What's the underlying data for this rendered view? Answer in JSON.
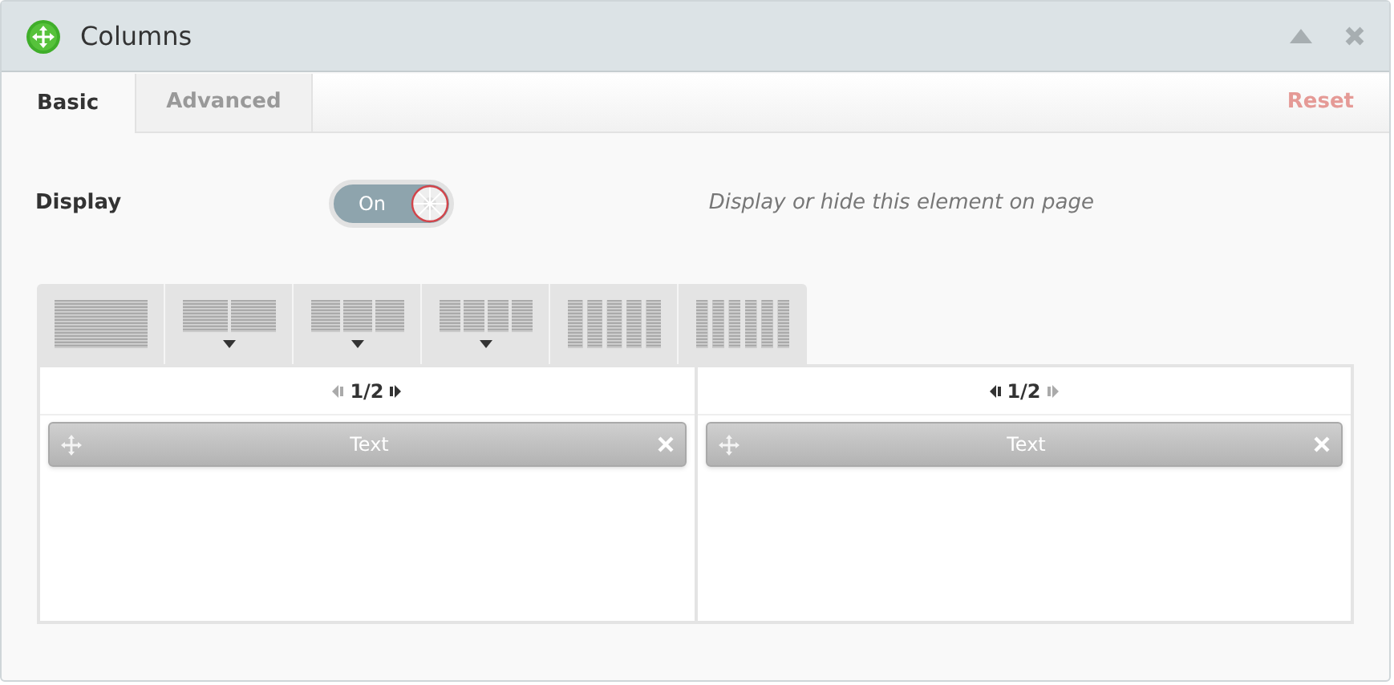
{
  "window": {
    "title": "Columns"
  },
  "tabs": [
    {
      "label": "Basic",
      "selected": true
    },
    {
      "label": "Advanced",
      "selected": false
    }
  ],
  "reset_label": "Reset",
  "display": {
    "label": "Display",
    "on": true,
    "toggle_text": "On",
    "hint": "Display or hide this element on page"
  },
  "layout_presets": [
    {
      "kind": "single",
      "has_menu": false
    },
    {
      "kind": "halves",
      "has_menu": true
    },
    {
      "kind": "thirds",
      "has_menu": true
    },
    {
      "kind": "quarters",
      "has_menu": true
    },
    {
      "kind": "fifths",
      "has_menu": false
    },
    {
      "kind": "sixths",
      "has_menu": false
    }
  ],
  "columns": [
    {
      "width": "1/2",
      "shrink_enabled": false,
      "grow_enabled": true,
      "elements": [
        {
          "label": "Text"
        }
      ]
    },
    {
      "width": "1/2",
      "shrink_enabled": true,
      "grow_enabled": false,
      "elements": [
        {
          "label": "Text"
        }
      ]
    }
  ]
}
